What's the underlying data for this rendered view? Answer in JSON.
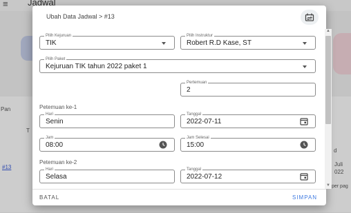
{
  "background": {
    "menu_icon": "≡",
    "title": "Jadwal",
    "left_partial": "Pan",
    "col_partial": "T",
    "row_link": "#13",
    "right_month": "Juli",
    "right_year": "022",
    "right_d": "d",
    "per_page": "per pag"
  },
  "dialog": {
    "title": "Ubah Data Jadwal > #13",
    "title_icon": "swap-calendar-icon",
    "fields": {
      "kejuruan": {
        "label": "Pilih Kejuruan",
        "value": "TIK"
      },
      "instruktur": {
        "label": "Pilih Instruktur",
        "value": "Robert R.D Kase, ST"
      },
      "paket": {
        "label": "Pilih Paket",
        "value": "Kejuruan TIK tahun 2022 paket 1"
      },
      "pertemuan": {
        "label": "Pertemuan",
        "value": "2"
      }
    },
    "meetings": [
      {
        "heading": "Petemuan ke-1",
        "hari_label": "Hari",
        "hari": "Senin",
        "tanggal_label": "Tanggal",
        "tanggal": "2022-07-11",
        "jam_label": "Jam",
        "jam": "08:00",
        "selesai_label": "Jam Selesai",
        "selesai": "15:00"
      },
      {
        "heading": "Petemuan ke-2",
        "hari_label": "Hari",
        "hari": "Selasa",
        "tanggal_label": "Tanggal",
        "tanggal": "2022-07-12"
      }
    ],
    "actions": {
      "cancel": "BATAL",
      "save": "SIMPAN"
    }
  },
  "colors": {
    "accent": "#3f7ae0",
    "scrim": "rgba(0,0,0,0.18)"
  }
}
